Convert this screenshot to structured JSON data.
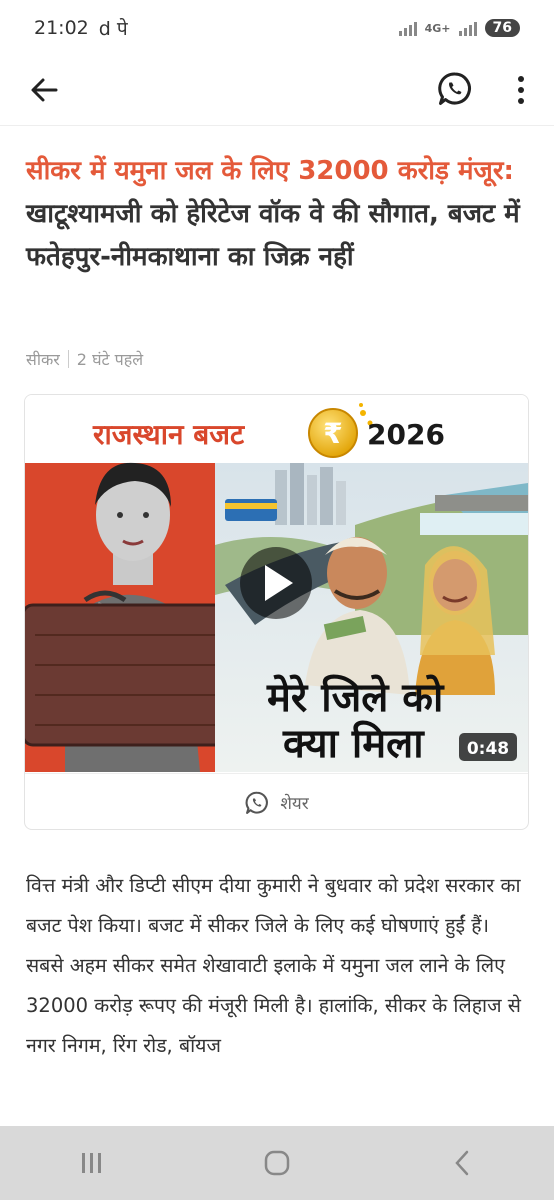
{
  "status": {
    "time": "21:02",
    "notif_glyphs": "d पे",
    "network_label": "4G+",
    "battery": "76"
  },
  "colors": {
    "accent": "#e45a3a",
    "thumb_left_bg": "#d9472c",
    "gold": "#f4b400"
  },
  "icons": {
    "back": "back-arrow-icon",
    "whatsapp": "whatsapp-icon",
    "menu": "more-vertical-icon",
    "play": "play-icon",
    "share": "whatsapp-icon"
  },
  "article": {
    "headline_highlight": "सीकर में यमुना जल के लिए 32000 करोड़ मंजूर:",
    "headline_rest": " खाटूश्यामजी को हेरिटेज वॉक वे की सौगात, बजट में फतेहपुर-नीमकाथाना का जिक्र नहीं",
    "location": "सीकर",
    "time_ago": "2 घंटे पहले",
    "body": "वित्त मंत्री और डिप्टी सीएम दीया कुमारी ने बुधवार को प्रदेश सरकार का बजट पेश किया। बजट में सीकर जिले के लिए कई घोषणाएं हुईं हैं। सबसे अहम सीकर समेत शेखावाटी इलाके में यमुना जल लाने के लिए 32000 करोड़ रूपए की मंजूरी मिली है। हालांकि, सीकर के लिहाज से नगर निगम, रिंग रोड, बॉयज"
  },
  "video": {
    "banner_title": "राजस्थान बजट",
    "banner_year": "2026",
    "coin_symbol": "₹",
    "caption_line1": "मेरे जिले को",
    "caption_line2": "क्या मिला",
    "duration": "0:48",
    "share_label": "शेयर"
  }
}
